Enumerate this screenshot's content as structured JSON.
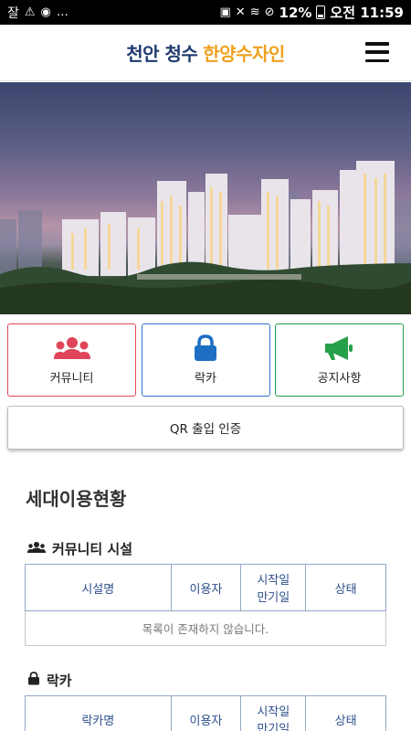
{
  "status_bar": {
    "left_text": "잘",
    "right_percent": "12%",
    "time": "오전 11:59"
  },
  "header": {
    "title_part1": "천안 청수",
    "title_part2": "한양수자인"
  },
  "quick_menu": [
    {
      "label": "커뮤니티",
      "icon": "users-icon",
      "color": "#e0455a"
    },
    {
      "label": "락카",
      "icon": "lock-icon",
      "color": "#2e78c8"
    },
    {
      "label": "공지사항",
      "icon": "megaphone-icon",
      "color": "#27a04a"
    }
  ],
  "qr_button": {
    "label": "QR 출입 인증"
  },
  "usage": {
    "title": "세대이용현황",
    "community": {
      "title": "커뮤니티 시설",
      "columns": [
        "시설명",
        "이용자",
        "시작일",
        "만기일",
        "상태"
      ],
      "empty_message": "목록이 존재하지 않습니다."
    },
    "locker": {
      "title": "락카",
      "columns": [
        "락카명",
        "이용자",
        "시작일",
        "만기일",
        "상태"
      ]
    }
  }
}
